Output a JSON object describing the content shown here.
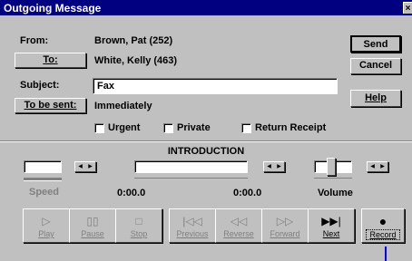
{
  "window": {
    "title": "Outgoing Message",
    "close_glyph": "×"
  },
  "from": {
    "label": "From:",
    "value": "Brown, Pat (252)"
  },
  "to": {
    "button": "To:",
    "value": "White, Kelly (463)"
  },
  "subject": {
    "label": "Subject:",
    "value": "Fax"
  },
  "send_time": {
    "button": "To be sent:",
    "value": "Immediately"
  },
  "options": {
    "urgent": "Urgent",
    "private": "Private",
    "return_receipt": "Return Receipt"
  },
  "actions": {
    "send": "Send",
    "cancel": "Cancel",
    "help": "Help"
  },
  "recorder": {
    "title": "INTRODUCTION",
    "speed_label": "Speed",
    "position_time": "0:00.0",
    "length_time": "0:00.0",
    "volume_label": "Volume",
    "volume_level": 0.45
  },
  "transport": [
    {
      "label": "Play",
      "icon": "play-icon",
      "enabled": false
    },
    {
      "label": "Pause",
      "icon": "pause-icon",
      "enabled": false
    },
    {
      "label": "Stop",
      "icon": "stop-icon",
      "enabled": false
    },
    {
      "label": "Previous",
      "icon": "previous-icon",
      "enabled": false
    },
    {
      "label": "Reverse",
      "icon": "reverse-icon",
      "enabled": false
    },
    {
      "label": "Forward",
      "icon": "forward-icon",
      "enabled": false
    },
    {
      "label": "Next",
      "icon": "next-icon",
      "enabled": true
    },
    {
      "label": "Record",
      "icon": "record-icon",
      "enabled": true
    }
  ]
}
